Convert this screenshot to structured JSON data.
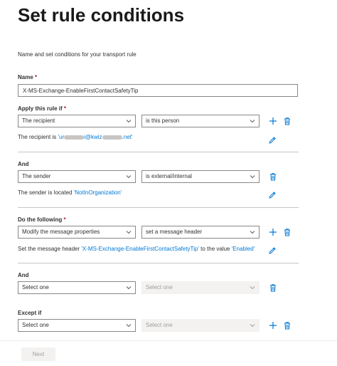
{
  "page": {
    "title": "Set rule conditions",
    "subtitle": "Name and set conditions for your transport rule"
  },
  "name_field": {
    "label": "Name",
    "required_mark": "*",
    "value": "X-MS-Exchange-EnableFirstContactSafetyTip"
  },
  "apply_section": {
    "label": "Apply this rule if",
    "required_mark": "*",
    "condition_select": "The recipient",
    "operator_select": "is this person",
    "summary_prefix": "The recipient is",
    "summary_value_start": "'ur",
    "summary_value_mid": "i@kwiz",
    "summary_value_end": ".net'"
  },
  "and_section_1": {
    "label": "And",
    "condition_select": "The sender",
    "operator_select": "is external/internal",
    "summary_prefix": "The sender is located",
    "summary_value": "'NotInOrganization'"
  },
  "do_section": {
    "label": "Do the following",
    "required_mark": "*",
    "action_select": "Modify the message properties",
    "operator_select": "set a message header",
    "summary_prefix": "Set the message header",
    "header_value": "'X-MS-Exchange-EnableFirstContactSafetyTip'",
    "summary_mid": "to the value",
    "value_value": "'Enabled'"
  },
  "and_section_2": {
    "label": "And",
    "condition_select": "Select one",
    "operator_select": "Select one"
  },
  "except_section": {
    "label": "Except if",
    "condition_select": "Select one",
    "operator_select": "Select one"
  },
  "footer": {
    "next_label": "Next"
  },
  "colors": {
    "accent": "#0078d4",
    "required": "#a4262c",
    "border": "#8a8886",
    "disabled_bg": "#f3f2f1"
  },
  "icons": [
    "chevron-down-icon",
    "add-icon",
    "delete-icon",
    "edit-icon"
  ]
}
